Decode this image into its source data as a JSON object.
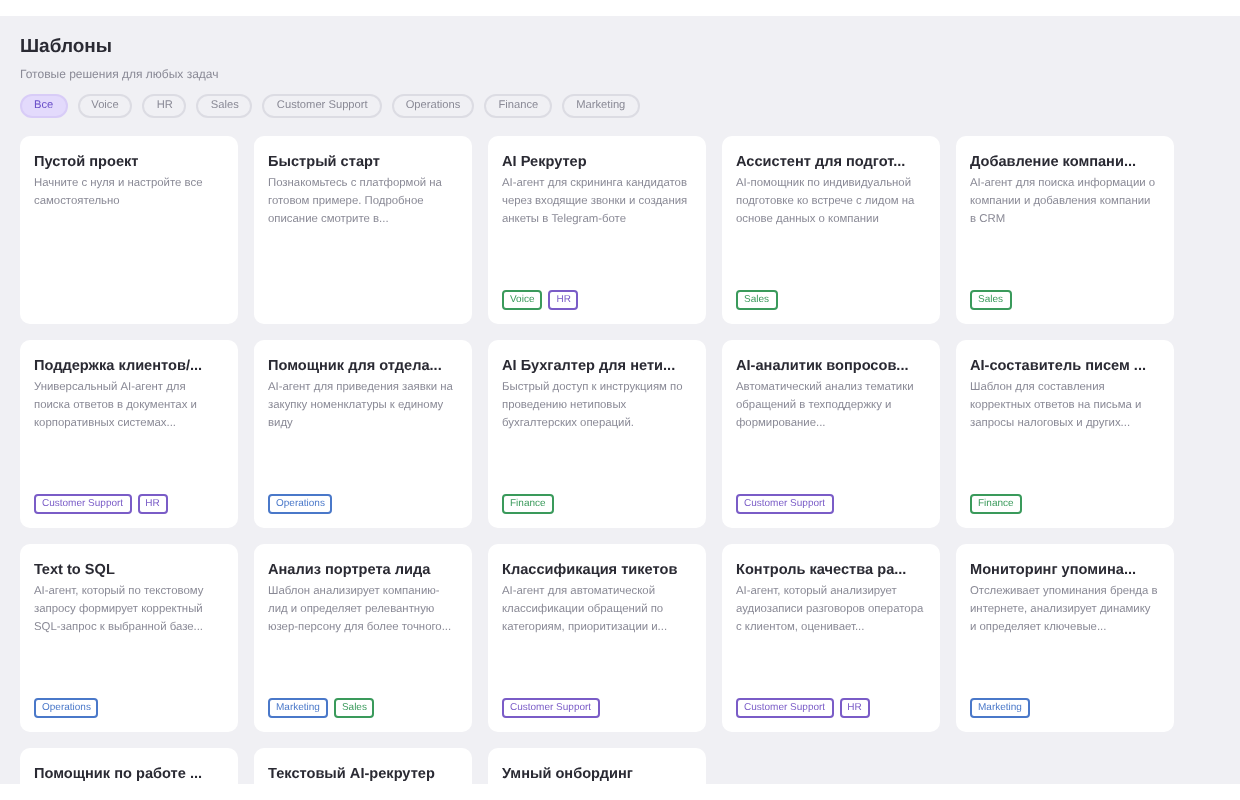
{
  "header": {
    "title": "Шаблоны",
    "subtitle": "Готовые решения для любых задач"
  },
  "filters": [
    {
      "label": "Все",
      "selected": true
    },
    {
      "label": "Voice",
      "selected": false
    },
    {
      "label": "HR",
      "selected": false
    },
    {
      "label": "Sales",
      "selected": false
    },
    {
      "label": "Customer Support",
      "selected": false
    },
    {
      "label": "Operations",
      "selected": false
    },
    {
      "label": "Finance",
      "selected": false
    },
    {
      "label": "Marketing",
      "selected": false
    }
  ],
  "cards": [
    {
      "title": "Пустой проект",
      "description": "Начните с нуля и настройте все самостоятельно"
    },
    {
      "title": "Быстрый старт",
      "description": "Познакомьтесь с платформой на готовом примере. Подробное описание смотрите в..."
    },
    {
      "title": "AI Рекрутер",
      "description": "AI-агент для скрининга кандидатов через входящие звонки и создания анкеты в Telegram-боте",
      "tags": [
        {
          "label": "Voice",
          "color": "#3a9a5b"
        },
        {
          "label": "HR",
          "color": "#7a5cc7"
        }
      ]
    },
    {
      "title": "Ассистент для подгот...",
      "description": "AI-помощник по индивидуальной подготовке ко встрече с лидом на основе данных о компании",
      "tags": [
        {
          "label": "Sales",
          "color": "#3a9a5b"
        }
      ]
    },
    {
      "title": "Добавление компани...",
      "description": "AI-агент для поиска информации о компании и добавления компании в CRM",
      "tags": [
        {
          "label": "Sales",
          "color": "#3a9a5b"
        }
      ]
    },
    {
      "title": "Поддержка клиентов/...",
      "description": "Универсальный AI-агент для поиска ответов в документах и корпоративных системах...",
      "tags": [
        {
          "label": "Customer Support",
          "color": "#7a5cc7"
        },
        {
          "label": "HR",
          "color": "#7a5cc7"
        }
      ]
    },
    {
      "title": "Помощник для отдела...",
      "description": "AI-агент для приведения заявки на закупку номенклатуры к единому виду",
      "tags": [
        {
          "label": "Operations",
          "color": "#4a78c9"
        }
      ]
    },
    {
      "title": "AI Бухгалтер для нети...",
      "description": "Быстрый доступ к инструкциям по проведению нетиповых бухгалтерских операций.",
      "tags": [
        {
          "label": "Finance",
          "color": "#3a9a5b"
        }
      ]
    },
    {
      "title": "AI-аналитик вопросов...",
      "description": "Автоматический анализ тематики обращений в техподдержку и формирование...",
      "tags": [
        {
          "label": "Customer Support",
          "color": "#7a5cc7"
        }
      ]
    },
    {
      "title": "AI-составитель писем ...",
      "description": "Шаблон для составления корректных ответов на письма и запросы налоговых и других...",
      "tags": [
        {
          "label": "Finance",
          "color": "#3a9a5b"
        }
      ]
    },
    {
      "title": "Text to SQL",
      "description": "AI-агент, который по текстовому запросу формирует корректный SQL-запрос к выбранной базе...",
      "tags": [
        {
          "label": "Operations",
          "color": "#4a78c9"
        }
      ]
    },
    {
      "title": "Анализ портрета лида",
      "description": "Шаблон анализирует компанию-лид и определяет релевантную юзер-персону для более точного...",
      "tags": [
        {
          "label": "Marketing",
          "color": "#4a78c9"
        },
        {
          "label": "Sales",
          "color": "#3a9a5b"
        }
      ]
    },
    {
      "title": "Классификация тикетов",
      "description": "AI-агент для автоматической классификации обращений по категориям, приоритизации и...",
      "tags": [
        {
          "label": "Customer Support",
          "color": "#7a5cc7"
        }
      ]
    },
    {
      "title": "Контроль качества ра...",
      "description": "AI-агент, который анализирует аудиозаписи разговоров оператора с клиентом, оценивает...",
      "tags": [
        {
          "label": "Customer Support",
          "color": "#7a5cc7"
        },
        {
          "label": "HR",
          "color": "#7a5cc7"
        }
      ]
    },
    {
      "title": "Мониторинг упомина...",
      "description": "Отслеживает упоминания бренда в интернете, анализирует динамику и определяет ключевые...",
      "tags": [
        {
          "label": "Marketing",
          "color": "#4a78c9"
        }
      ]
    },
    {
      "title": "Помощник по работе ..."
    },
    {
      "title": "Текстовый AI-рекрутер"
    },
    {
      "title": "Умный онбординг"
    }
  ]
}
